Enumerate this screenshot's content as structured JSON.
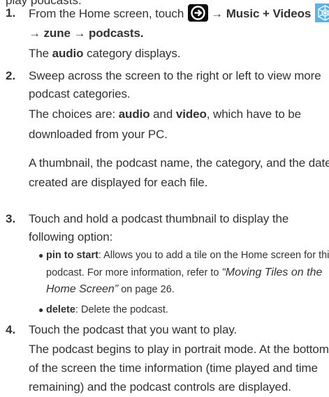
{
  "header_fragment": "play podcasts.",
  "steps": [
    {
      "num": "1.",
      "l1_a": "From the Home screen, touch",
      "arrow_sym": "→",
      "l1_b": "Music + Videos",
      "icon_start": "start-arrow-icon",
      "icon_music": "music-videos-icon",
      "l2_a": "→ zune → podcasts",
      "l2_b": ".",
      "l3_a": "The",
      "l3_b": "audio",
      "l3_c": "category displays."
    },
    {
      "num": "2.",
      "l1": "Sweep across the screen to the right or left to view more",
      "l2": "podcast categories.",
      "l3_a": "The choices are:",
      "l3_b": "audio",
      "l3_c": "and",
      "l3_d": "video",
      "l3_e": ", which have to be",
      "l4": "downloaded from your PC.",
      "l5": "A thumbnail, the podcast name, the category, and the date",
      "l6": "created are displayed for each file."
    },
    {
      "num": "3.",
      "l1": "Touch and hold a podcast thumbnail to display the",
      "l2": "following option:",
      "bullets": [
        {
          "term": "pin to start",
          "l1_rest": ": Allows you to add a tile on the Home screen for this",
          "l2_a": "podcast. For more information, refer to",
          "l2_link": "“Moving Tiles on the",
          "l3_link": "Home Screen”",
          "l3_rest": "on page 26."
        },
        {
          "term": "delete",
          "rest": ": Delete the podcast."
        }
      ]
    },
    {
      "num": "4.",
      "l1": "Touch the podcast that you want to play.",
      "l2": "The podcast begins to play in portrait mode. At the bottom",
      "l3": "of the screen the time information (time played and time",
      "l4": "remaining) and the podcast controls are displayed."
    }
  ],
  "colors": {
    "text": "#333333",
    "icon_dark": "#0d0d0d",
    "icon_blue": "#56b4ea"
  }
}
